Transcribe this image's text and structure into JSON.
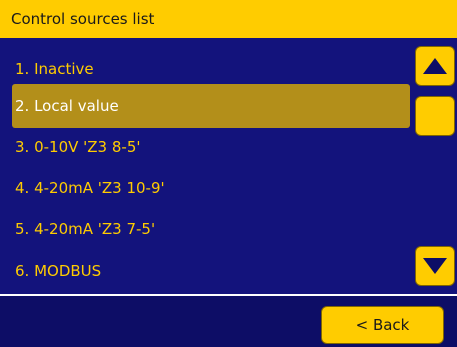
{
  "header": {
    "title": "Control sources list"
  },
  "list": {
    "items": [
      {
        "label": "1. Inactive"
      },
      {
        "label": "2. Local value"
      },
      {
        "label": "3. 0-10V 'Z3 8-5'"
      },
      {
        "label": "4. 4-20mA 'Z3 10-9'"
      },
      {
        "label": "5. 4-20mA 'Z3 7-5'"
      },
      {
        "label": "6. MODBUS"
      }
    ],
    "selected_index": 2
  },
  "scroll": {
    "up_icon": "up-triangle-icon",
    "down_icon": "down-triangle-icon"
  },
  "footer": {
    "back_label": "< Back"
  },
  "colors": {
    "background": "#0d0d66",
    "panel": "#13137c",
    "accent": "#ffcc00",
    "selected": "#b38f1a",
    "icon": "#0d0d66"
  }
}
